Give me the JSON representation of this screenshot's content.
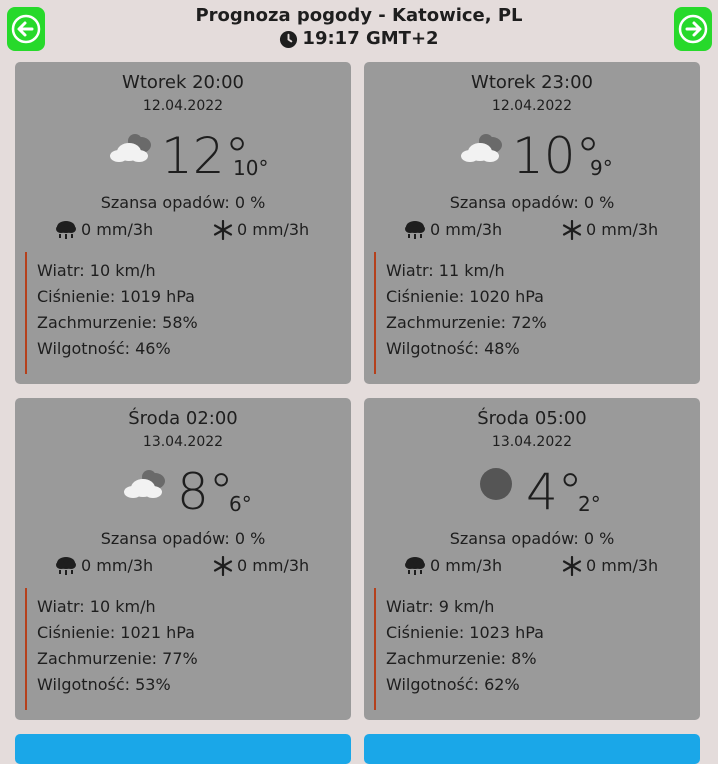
{
  "header": {
    "title": "Prognoza pogody - Katowice, PL",
    "time": "19:17 GMT+2",
    "prev_icon": "arrow-left-icon",
    "next_icon": "arrow-right-icon"
  },
  "colors": {
    "nav_button": "#27d92b",
    "card": "#9a9a9a",
    "details_border": "#b5401c",
    "next_card": "#1aa7e8"
  },
  "cards": [
    {
      "day": "Wtorek 20:00",
      "date": "12.04.2022",
      "icon": "partly-cloudy-icon",
      "temp": "12°",
      "temp_min": "10°",
      "chance": "Szansa opadów: 0 %",
      "rain": "0 mm/3h",
      "snow": "0 mm/3h",
      "wind": "Wiatr: 10 km/h",
      "pressure": "Ciśnienie: 1019 hPa",
      "clouds": "Zachmurzenie: 58%",
      "humidity": "Wilgotność: 46%"
    },
    {
      "day": "Wtorek 23:00",
      "date": "12.04.2022",
      "icon": "partly-cloudy-icon",
      "temp": "10°",
      "temp_min": "9°",
      "chance": "Szansa opadów: 0 %",
      "rain": "0 mm/3h",
      "snow": "0 mm/3h",
      "wind": "Wiatr: 11 km/h",
      "pressure": "Ciśnienie: 1020 hPa",
      "clouds": "Zachmurzenie: 72%",
      "humidity": "Wilgotność: 48%"
    },
    {
      "day": "Środa 02:00",
      "date": "13.04.2022",
      "icon": "partly-cloudy-icon",
      "temp": "8°",
      "temp_min": "6°",
      "chance": "Szansa opadów: 0 %",
      "rain": "0 mm/3h",
      "snow": "0 mm/3h",
      "wind": "Wiatr: 10 km/h",
      "pressure": "Ciśnienie: 1021 hPa",
      "clouds": "Zachmurzenie: 77%",
      "humidity": "Wilgotność: 53%"
    },
    {
      "day": "Środa 05:00",
      "date": "13.04.2022",
      "icon": "clear-night-icon",
      "temp": "4°",
      "temp_min": "2°",
      "chance": "Szansa opadów: 0 %",
      "rain": "0 mm/3h",
      "snow": "0 mm/3h",
      "wind": "Wiatr: 9 km/h",
      "pressure": "Ciśnienie: 1023 hPa",
      "clouds": "Zachmurzenie: 8%",
      "humidity": "Wilgotność: 62%"
    }
  ]
}
